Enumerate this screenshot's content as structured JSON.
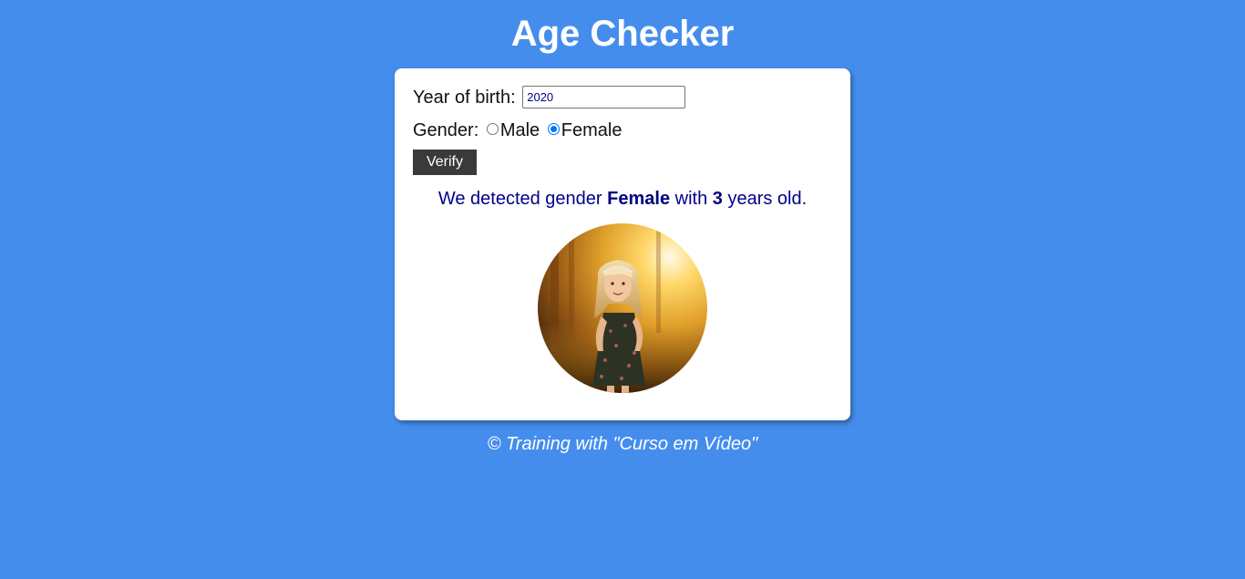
{
  "header": {
    "title": "Age Checker"
  },
  "form": {
    "year_label": "Year of birth:",
    "year_value": "2020",
    "gender_label": "Gender:",
    "gender_options": [
      {
        "label": "Male",
        "checked": false
      },
      {
        "label": "Female",
        "checked": true
      }
    ],
    "verify_label": "Verify"
  },
  "result": {
    "prefix": "We detected gender ",
    "gender": "Female",
    "middle": " with ",
    "age": "3",
    "suffix": " years old."
  },
  "photo": {
    "icon": "girl-photo"
  },
  "footer": {
    "text": "© Training with \"Curso em Vídeo\""
  },
  "colors": {
    "background": "#458ded",
    "result_text": "#00008b",
    "button": "#3a3a3a",
    "radio_accent": "#0075ff"
  }
}
